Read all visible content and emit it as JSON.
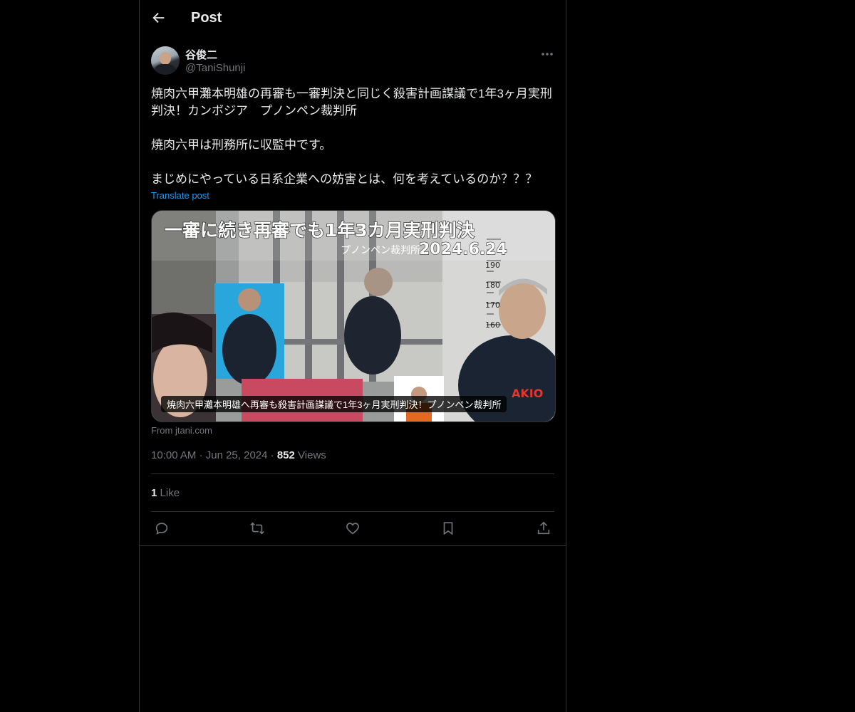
{
  "header": {
    "title": "Post",
    "back_icon": "arrow-left-icon"
  },
  "author": {
    "display_name": "谷俊二",
    "handle": "@TaniShunji"
  },
  "post": {
    "text": "焼肉六甲灘本明雄の再審も一審判決と同じく殺害計画謀議で1年3ヶ月実刑判決！カンボジア　プノンペン裁判所\n\n焼肉六甲は刑務所に収監中です。\n\nまじめにやっている日系企業への妨害とは、何を考えているのか？？？",
    "translate_label": "Translate post"
  },
  "card": {
    "image_title": "一審に続き再審でも1年3カ月実刑判決",
    "image_subtitle": "プノンペン裁判所",
    "image_date": "2024.6.24",
    "image_height_labels": [
      "190",
      "180",
      "170",
      "160"
    ],
    "image_name_tag": "AKIO",
    "caption": "焼肉六甲灘本明雄へ再審も殺害計画謀議で1年3ヶ月実刑判決！プノンペン裁判所",
    "source": "From jtani.com"
  },
  "meta": {
    "time": "10:00 AM",
    "date": "Jun 25, 2024",
    "views_count": "852",
    "views_label": "Views"
  },
  "stats": {
    "likes_count": "1",
    "likes_label": "Like"
  },
  "actions": [
    "reply-icon",
    "repost-icon",
    "like-icon",
    "bookmark-icon",
    "share-icon"
  ],
  "colors": {
    "background": "#000000",
    "text": "#e7e9ea",
    "muted": "#71767b",
    "link": "#1d9bf0",
    "border": "#2f3336"
  }
}
